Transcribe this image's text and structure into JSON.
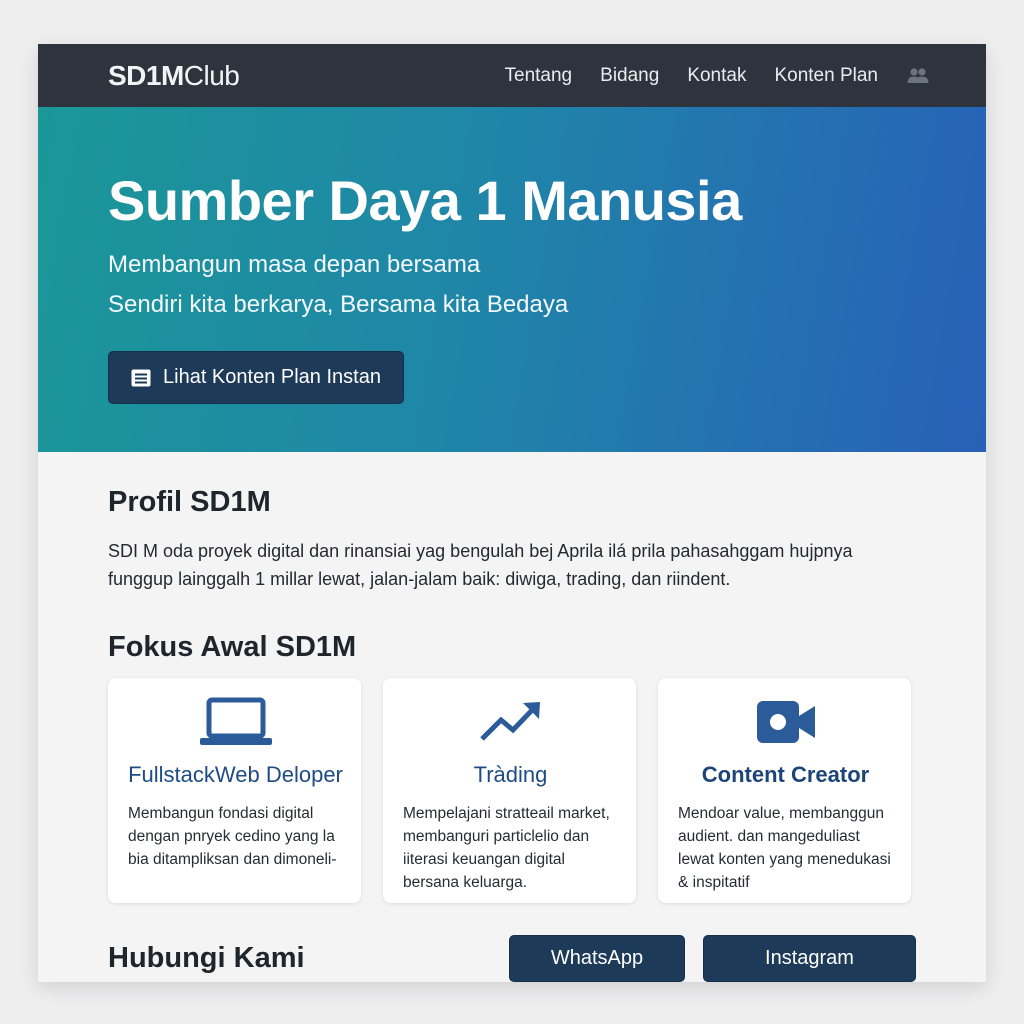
{
  "navbar": {
    "brand_bold": "SD1M",
    "brand_light": "Club",
    "links": [
      "Tentang",
      "Bidang",
      "Kontak",
      "Konten Plan"
    ],
    "user_icon": "users-icon"
  },
  "hero": {
    "title": "Sumber Daya 1 Manusia",
    "subtitle": "Membangun masa depan bersama",
    "tagline": "Sendiri kita berkarya, Bersama kita Bedaya",
    "button_label": "Lihat Konten Plan Instan",
    "button_icon": "document-icon"
  },
  "profile": {
    "title": "Profil SD1M",
    "text": "SDI M oda proyek digital dan rinansiai yag bengulah bej Aprila ilá prila pahasahggam hujpnya funggup lainggalh 1 millar lewat, jalan-jalam baik: diwiga, trading, dan riindent."
  },
  "focus": {
    "title": "Fokus Awal SD1M",
    "cards": [
      {
        "icon": "laptop-icon",
        "title": "FullstackWeb Deloper",
        "desc": "Membangun fondasi digital dengan pnryek cedino yang la bia ditampliksan dan dimoneli-"
      },
      {
        "icon": "trending-up-icon",
        "title": "Tràding",
        "desc": "Mempelajani stratteail market, membanguri particlelio dan iiterasi keuangan digital bersana keluarga."
      },
      {
        "icon": "video-camera-icon",
        "title": "Content Creator",
        "desc": "Mendoar value, membanggun audient.  dan mangeduliast lewat konten yang menedukasi & inspitatif"
      }
    ]
  },
  "contact": {
    "title": "Hubungi Kami",
    "whatsapp_label": "WhatsApp",
    "instagram_label": "Instagram"
  },
  "colors": {
    "navbar_bg": "#2d343d",
    "hero_gradient_start": "#1b9798",
    "hero_gradient_end": "#2860b8",
    "button_bg": "#1d3a58",
    "accent_blue": "#1e4c86"
  }
}
